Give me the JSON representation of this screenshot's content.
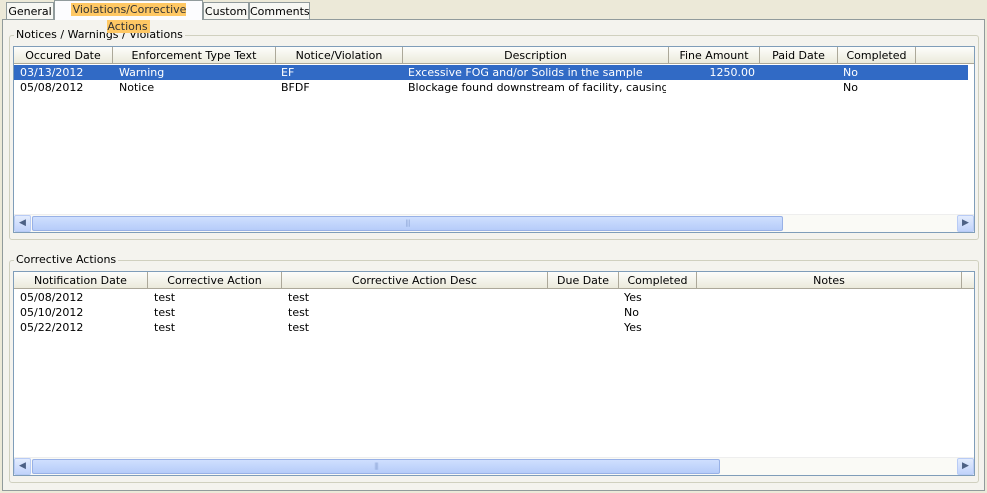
{
  "tabs": [
    {
      "label": "General"
    },
    {
      "label": "Violations/Corrective Actions"
    },
    {
      "label": "Custom"
    },
    {
      "label": "Comments"
    }
  ],
  "notices": {
    "title": "Notices / Warnings / Violations",
    "columns": [
      "Occured Date",
      "Enforcement Type Text",
      "Notice/Violation",
      "Description",
      "Fine Amount",
      "Paid Date",
      "Completed"
    ],
    "rows": [
      [
        "03/13/2012",
        "Warning",
        "EF",
        "Excessive FOG and/or Solids in the sample",
        "1250.00",
        "",
        "No"
      ],
      [
        "05/08/2012",
        "Notice",
        "BFDF",
        "Blockage found downstream of facility, causing dam...",
        "",
        "",
        "No"
      ]
    ],
    "selected_row": 0
  },
  "corrective": {
    "title": "Corrective Actions",
    "columns": [
      "Notification Date",
      "Corrective Action",
      "Corrective Action Desc",
      "Due Date",
      "Completed",
      "Notes"
    ],
    "rows": [
      [
        "05/08/2012",
        "test",
        "test",
        "",
        "Yes",
        ""
      ],
      [
        "05/10/2012",
        "test",
        "test",
        "",
        "No",
        ""
      ],
      [
        "05/22/2012",
        "test",
        "test",
        "",
        "Yes",
        ""
      ]
    ]
  },
  "colors": {
    "selection": "#316ac5",
    "active_tab_highlight": "#ffc864"
  }
}
